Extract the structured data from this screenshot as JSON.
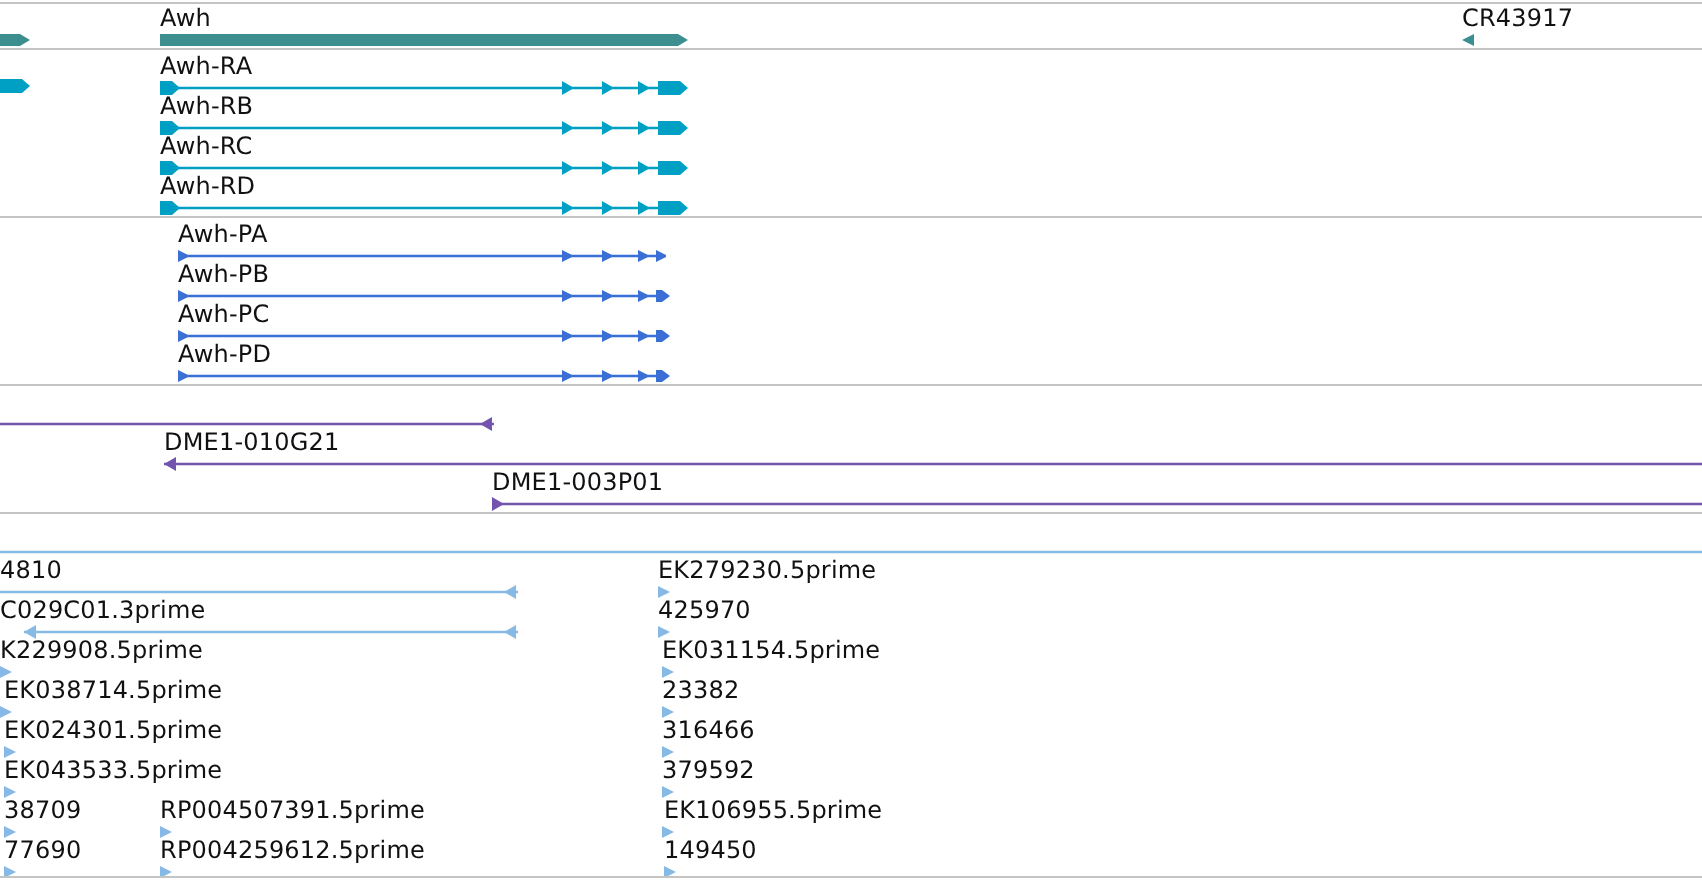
{
  "tracks": [
    {
      "kind": "gene",
      "color": "#3d8f8f",
      "features": [
        {
          "reverse": false
        },
        {
          "label": "Awh",
          "reverse": false
        },
        {
          "label": "CR43917",
          "reverse": true
        }
      ]
    },
    {
      "kind": "transcript",
      "color": "#00a0c4",
      "features": [
        {
          "reverse": false
        },
        {
          "label": "Awh-RA",
          "reverse": false
        },
        {
          "label": "Awh-RB",
          "reverse": false
        },
        {
          "label": "Awh-RC",
          "reverse": false
        },
        {
          "label": "Awh-RD",
          "reverse": false
        }
      ]
    },
    {
      "kind": "protein",
      "color": "#3a6fd6",
      "features": [
        {
          "label": "Awh-PA",
          "reverse": false
        },
        {
          "label": "Awh-PB",
          "reverse": false
        },
        {
          "label": "Awh-PC",
          "reverse": false
        },
        {
          "label": "Awh-PD",
          "reverse": false
        }
      ]
    },
    {
      "kind": "clone",
      "color": "#7353ad",
      "features": [
        {
          "reverse": true
        },
        {
          "label": "DME1-010G21",
          "reverse": true
        },
        {
          "label": "DME1-003P01",
          "reverse": false
        }
      ]
    },
    {
      "kind": "est",
      "color": "#86b9e3",
      "features": [
        {
          "kind": "span"
        },
        {
          "kind": "span",
          "label": "4810",
          "reverse": true
        },
        {
          "kind": "span",
          "label": "C029C01.3prime",
          "reverse": true
        },
        {
          "label": "K229908.5prime",
          "reverse": false
        },
        {
          "label": "EK038714.5prime",
          "reverse": false
        },
        {
          "label": "EK024301.5prime",
          "reverse": false
        },
        {
          "label": "EK043533.5prime",
          "reverse": false
        },
        {
          "label": "38709",
          "reverse": false
        },
        {
          "label": "77690",
          "reverse": false
        },
        {
          "label": "RP004507391.5prime",
          "reverse": false
        },
        {
          "label": "RP004259612.5prime",
          "reverse": false
        },
        {
          "label": "EK279230.5prime",
          "reverse": false
        },
        {
          "label": "425970",
          "reverse": false
        },
        {
          "label": "EK031154.5prime",
          "reverse": false
        },
        {
          "label": "23382",
          "reverse": false
        },
        {
          "label": "316466",
          "reverse": false
        },
        {
          "label": "379592",
          "reverse": false
        },
        {
          "label": "EK106955.5prime",
          "reverse": false
        },
        {
          "label": "149450",
          "reverse": false
        }
      ]
    }
  ]
}
